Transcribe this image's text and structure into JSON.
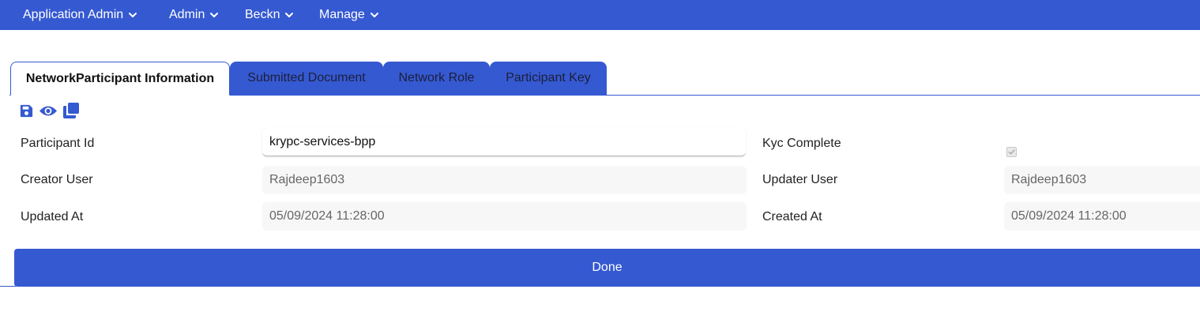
{
  "colors": {
    "primary": "#3559d1",
    "field_bg": "#f7f7f7"
  },
  "nav": {
    "items": [
      {
        "label": "Application Admin",
        "icon": "chevron-down-icon"
      },
      {
        "label": "Admin",
        "icon": "chevron-down-icon"
      },
      {
        "label": "Beckn",
        "icon": "chevron-down-icon"
      },
      {
        "label": "Manage",
        "icon": "chevron-down-icon"
      }
    ]
  },
  "tabs": [
    {
      "label": "NetworkParticipant Information",
      "active": true
    },
    {
      "label": "Submitted Document",
      "active": false
    },
    {
      "label": "Network Role",
      "active": false
    },
    {
      "label": "Participant Key",
      "active": false
    }
  ],
  "toolbar": {
    "icons": [
      "save-icon",
      "eye-icon",
      "copy-icon"
    ]
  },
  "form": {
    "participant_id": {
      "label": "Participant Id",
      "value": "krypc-services-bpp"
    },
    "kyc_complete": {
      "label": "Kyc Complete",
      "checked": true,
      "disabled": true
    },
    "creator_user": {
      "label": "Creator User",
      "value": "Rajdeep1603"
    },
    "updater_user": {
      "label": "Updater User",
      "value": "Rajdeep1603"
    },
    "updated_at": {
      "label": "Updated At",
      "value": "05/09/2024 11:28:00"
    },
    "created_at": {
      "label": "Created At",
      "value": "05/09/2024 11:28:00"
    }
  },
  "actions": {
    "done_label": "Done"
  }
}
